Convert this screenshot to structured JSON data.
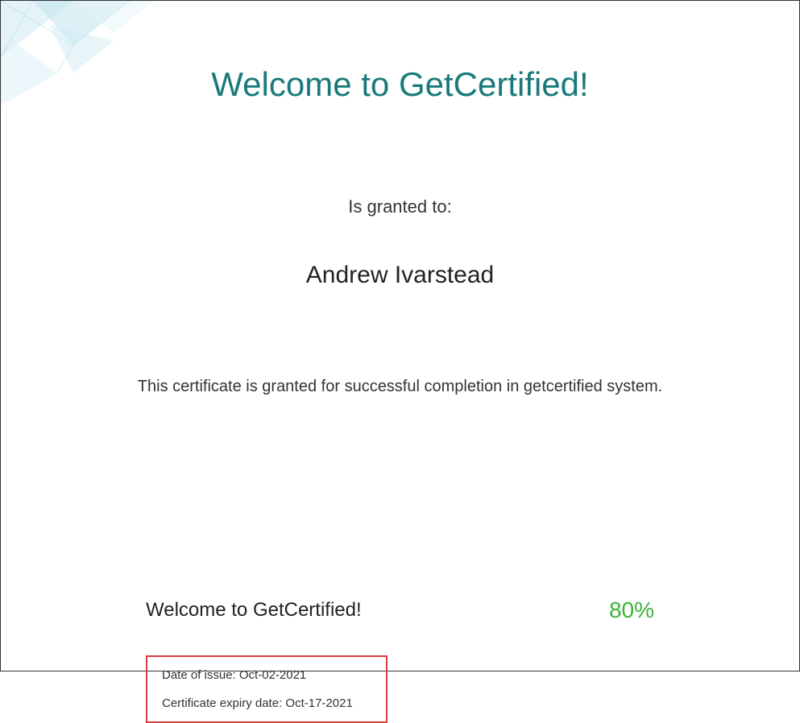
{
  "header": {
    "title": "Welcome to GetCertified!"
  },
  "body": {
    "granted_to_label": "Is granted to:",
    "recipient_name": "Andrew  Ivarstead",
    "description": "This certificate is granted for successful completion in getcertified system."
  },
  "footer": {
    "course_name": "Welcome to GetCertified!",
    "score": "80%",
    "issue_label": "Date of issue: ",
    "issue_date": "Oct-02-2021",
    "expiry_label": "Certificate expiry date: ",
    "expiry_date": "Oct-17-2021"
  }
}
